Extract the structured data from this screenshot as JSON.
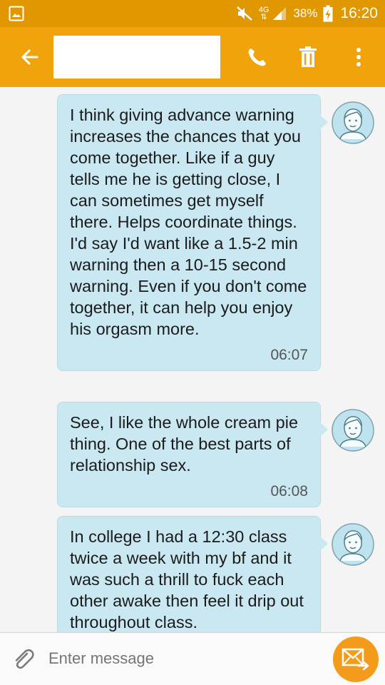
{
  "status_bar": {
    "network": "4G",
    "network_arrows": "⇅",
    "battery_percent": "38%",
    "time": "16:20"
  },
  "app_bar": {
    "contact_name": ""
  },
  "messages": [
    {
      "text": "I think giving advance warning increases the chances that you come together. Like if a guy tells me he is getting close, I can sometimes get myself there. Helps coordinate things. I'd say I'd want like a 1.5-2 min warning then a 10-15 second warning. Even if you don't come together, it can help you enjoy his orgasm more.",
      "time": "06:07"
    },
    {
      "text": "See, I like the whole cream pie thing. One of the best parts of relationship sex.",
      "time": "06:08"
    },
    {
      "text": "In college I had a 12:30 class twice a week with my bf and it was such a thrill to fuck each other awake then feel it drip out throughout class.",
      "time": ""
    }
  ],
  "composer": {
    "placeholder": "Enter message"
  },
  "colors": {
    "status_bar": "#e19800",
    "app_bar": "#f0a30a",
    "bubble": "#c9e8f2",
    "send_button": "#f39c1b",
    "avatar_bg": "#bfe3ee"
  },
  "icons": {
    "status_left": "gallery-icon",
    "mute": "mute-icon",
    "signal": "signal-icon",
    "battery": "battery-charging-icon",
    "back": "back-arrow-icon",
    "call": "phone-icon",
    "delete": "trash-icon",
    "more": "more-vert-icon",
    "attach": "paperclip-icon",
    "send": "send-icon",
    "avatar": "contact-avatar-icon"
  }
}
